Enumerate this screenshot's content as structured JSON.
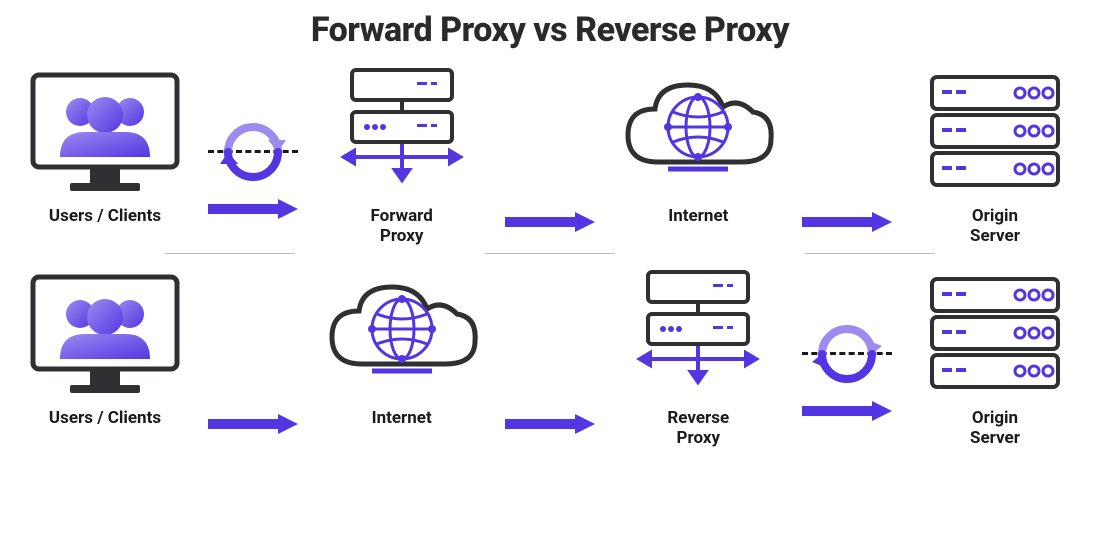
{
  "title": "Forward Proxy vs Reverse Proxy",
  "colors": {
    "accent": "#5336E2",
    "accentLight": "#9D8BF0",
    "stroke": "#2f3031",
    "text": "#2a2a2a"
  },
  "rows": [
    {
      "kind": "forward",
      "nodes": [
        {
          "key": "users",
          "label": "Users / Clients"
        },
        {
          "key": "proxy",
          "label": "Forward\nProxy"
        },
        {
          "key": "internet",
          "label": "Internet"
        },
        {
          "key": "origin",
          "label": "Origin\nServer"
        }
      ]
    },
    {
      "kind": "reverse",
      "nodes": [
        {
          "key": "users",
          "label": "Users / Clients"
        },
        {
          "key": "internet",
          "label": "Internet"
        },
        {
          "key": "proxy",
          "label": "Reverse\nProxy"
        },
        {
          "key": "origin",
          "label": "Origin\nServer"
        }
      ]
    }
  ]
}
